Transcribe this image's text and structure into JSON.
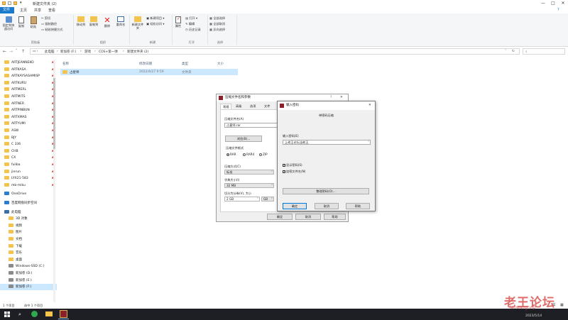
{
  "window": {
    "title": "新建文件夹 (2)"
  },
  "ribbon": {
    "tabs": [
      "文件",
      "主页",
      "共享",
      "查看"
    ],
    "clipboard": {
      "pin": "固定到快速访问",
      "copy": "复制",
      "paste": "粘贴",
      "cut": "剪切",
      "copy_path": "复制路径",
      "paste_shortcut": "粘贴快捷方式",
      "group": "剪贴板"
    },
    "organize": {
      "move_to": "移动到",
      "copy_to": "复制到",
      "delete": "删除",
      "rename": "重命名",
      "group": "组织"
    },
    "new": {
      "new_folder": "新建文件夹",
      "new_item": "新建项目",
      "easy_access": "轻松访问",
      "group": "新建"
    },
    "open": {
      "properties": "属性",
      "open": "打开",
      "edit": "编辑",
      "history": "历史记录",
      "group": "打开"
    },
    "select": {
      "select_all": "全部选择",
      "select_none": "全部取消",
      "invert": "反向选择",
      "group": "选择"
    }
  },
  "address": {
    "crumbs": [
      "此电脑",
      "新加卷 (F:)",
      "游戏",
      "COS+第一弹",
      "新建文件夹 (2)"
    ]
  },
  "nav": {
    "quick": [
      "ARTJEANNEKO",
      "ARTKASA",
      "ARTKAYSASHMISP",
      "ARTKURU",
      "ARTMERL",
      "ARTMITS",
      "ARTNER",
      "ARTPINBUN",
      "ARTXMAS",
      "ARTYUMI",
      "ASW",
      "BJY",
      "C 336",
      "CHB",
      "CX",
      "fuliba",
      "jinrun",
      "LYX21-583",
      "mb-miku"
    ],
    "onedrive": "OneDrive",
    "baidu": "百度网盘同步空间",
    "thispc": "此电脑",
    "pc_items": [
      "3D 对象",
      "视频",
      "图片",
      "文档",
      "下载",
      "音乐",
      "桌面",
      "Windows-SSD (C:)",
      "新加卷 (D:)",
      "新加卷 (E:)",
      "新加卷 (F:)"
    ]
  },
  "list": {
    "headers": [
      "名称",
      "修改日期",
      "类型",
      "大小"
    ],
    "rows": [
      {
        "name": "占星师",
        "date": "2022/4/27 9:59",
        "type": "文件夹",
        "size": ""
      }
    ]
  },
  "status": {
    "count": "1 个项目",
    "selected": "选中 1 个项目"
  },
  "rar": {
    "title": "压缩文件名和参数",
    "tabs": [
      "常规",
      "高级",
      "选项",
      "文件"
    ],
    "archive_label": "压缩文件名(A)",
    "archive_value": "占星师.rar",
    "browse": "浏览(B)...",
    "format_label": "压缩文件格式",
    "formats": [
      "RAR",
      "RAR4",
      "ZIP"
    ],
    "method_label": "压缩方式(C)",
    "method_value": "标准",
    "dict_label": "字典大小(I)",
    "dict_value": "32 MB",
    "split_label": "切分为分卷(V), 大小",
    "split_value": "2 GB",
    "split_unit": "GB",
    "ok": "确定",
    "cancel": "取消",
    "help": "帮助"
  },
  "pwd": {
    "title": "输入密码",
    "subtitle": "带密码压缩",
    "label": "输入密码(E)",
    "value": "上老王论坛当老王",
    "show_pwd": "显示密码(S)",
    "encrypt_names": "加密文件名(N)",
    "manage": "整理密码(O)...",
    "ok": "确定",
    "cancel": "取消",
    "help": "帮助"
  },
  "taskbar": {
    "time": "2023/5/14"
  },
  "watermark": {
    "text": "老王论坛",
    "url": "laowang.vip"
  }
}
